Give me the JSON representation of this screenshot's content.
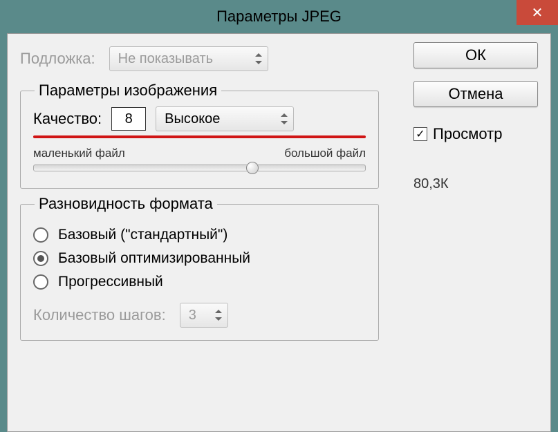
{
  "title": "Параметры JPEG",
  "close_glyph": "✕",
  "matte": {
    "label": "Подложка:",
    "value": "Не показывать"
  },
  "buttons": {
    "ok": "ОК",
    "cancel": "Отмена"
  },
  "image_options": {
    "legend": "Параметры изображения",
    "quality_label": "Качество:",
    "quality_value": "8",
    "quality_preset": "Высокое",
    "slider_min_label": "маленький файл",
    "slider_max_label": "большой файл"
  },
  "preview": {
    "label": "Просмотр",
    "checked": true,
    "filesize": "80,3К"
  },
  "format": {
    "legend": "Разновидность формата",
    "options": [
      {
        "label": "Базовый (\"стандартный\")",
        "checked": false
      },
      {
        "label": "Базовый оптимизированный",
        "checked": true
      },
      {
        "label": "Прогрессивный",
        "checked": false
      }
    ],
    "scans_label": "Количество шагов:",
    "scans_value": "3"
  }
}
